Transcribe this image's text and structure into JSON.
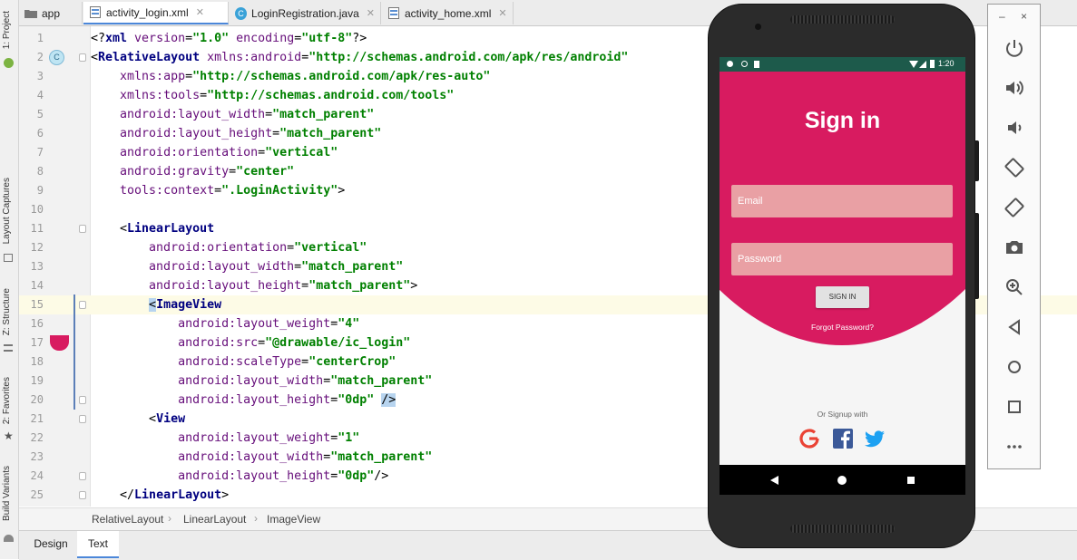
{
  "left_strip": {
    "tabs": [
      "1: Project",
      "Layout Captures",
      "Z: Structure",
      "2: Favorites",
      "Build Variants"
    ]
  },
  "tabs": [
    {
      "label": "app",
      "icon": "folder-icon"
    },
    {
      "label": "activity_login.xml",
      "icon": "xml-layout-icon"
    },
    {
      "label": "LoginRegistration.java",
      "icon": "class-icon"
    },
    {
      "label": "activity_home.xml",
      "icon": "xml-layout-icon"
    }
  ],
  "editor": {
    "gutter_badge": "C",
    "lines": [
      {
        "n": "1",
        "t": [
          [
            "p",
            "<?"
          ],
          [
            "k",
            "xml "
          ],
          [
            "a",
            "version"
          ],
          [
            "p",
            "="
          ],
          [
            "s",
            "\"1.0\""
          ],
          [
            "p",
            " "
          ],
          [
            "a",
            "encoding"
          ],
          [
            "p",
            "="
          ],
          [
            "s",
            "\"utf-8\""
          ],
          [
            "p",
            "?>"
          ]
        ]
      },
      {
        "n": "2",
        "t": [
          [
            "p",
            "<"
          ],
          [
            "k",
            "RelativeLayout "
          ],
          [
            "a",
            "xmlns:android"
          ],
          [
            "p",
            "="
          ],
          [
            "s",
            "\"http://schemas.android.com/apk/res/android\""
          ]
        ]
      },
      {
        "n": "3",
        "t": [
          [
            "p",
            "    "
          ],
          [
            "a",
            "xmlns:app"
          ],
          [
            "p",
            "="
          ],
          [
            "s",
            "\"http://schemas.android.com/apk/res-auto\""
          ]
        ]
      },
      {
        "n": "4",
        "t": [
          [
            "p",
            "    "
          ],
          [
            "a",
            "xmlns:tools"
          ],
          [
            "p",
            "="
          ],
          [
            "s",
            "\"http://schemas.android.com/tools\""
          ]
        ]
      },
      {
        "n": "5",
        "t": [
          [
            "p",
            "    "
          ],
          [
            "a",
            "android:layout_width"
          ],
          [
            "p",
            "="
          ],
          [
            "s",
            "\"match_parent\""
          ]
        ]
      },
      {
        "n": "6",
        "t": [
          [
            "p",
            "    "
          ],
          [
            "a",
            "android:layout_height"
          ],
          [
            "p",
            "="
          ],
          [
            "s",
            "\"match_parent\""
          ]
        ]
      },
      {
        "n": "7",
        "t": [
          [
            "p",
            "    "
          ],
          [
            "a",
            "android:orientation"
          ],
          [
            "p",
            "="
          ],
          [
            "s",
            "\"vertical\""
          ]
        ]
      },
      {
        "n": "8",
        "t": [
          [
            "p",
            "    "
          ],
          [
            "a",
            "android:gravity"
          ],
          [
            "p",
            "="
          ],
          [
            "s",
            "\"center\""
          ]
        ]
      },
      {
        "n": "9",
        "t": [
          [
            "p",
            "    "
          ],
          [
            "a",
            "tools:context"
          ],
          [
            "p",
            "="
          ],
          [
            "s",
            "\".LoginActivity\""
          ],
          [
            "p",
            ">"
          ]
        ]
      },
      {
        "n": "10",
        "t": []
      },
      {
        "n": "11",
        "t": [
          [
            "p",
            "    <"
          ],
          [
            "k",
            "LinearLayout"
          ]
        ]
      },
      {
        "n": "12",
        "t": [
          [
            "p",
            "        "
          ],
          [
            "a",
            "android:orientation"
          ],
          [
            "p",
            "="
          ],
          [
            "s",
            "\"vertical\""
          ]
        ]
      },
      {
        "n": "13",
        "t": [
          [
            "p",
            "        "
          ],
          [
            "a",
            "android:layout_width"
          ],
          [
            "p",
            "="
          ],
          [
            "s",
            "\"match_parent\""
          ]
        ]
      },
      {
        "n": "14",
        "t": [
          [
            "p",
            "        "
          ],
          [
            "a",
            "android:layout_height"
          ],
          [
            "p",
            "="
          ],
          [
            "s",
            "\"match_parent\""
          ],
          [
            "p",
            ">"
          ]
        ]
      },
      {
        "n": "15",
        "t": [
          [
            "p",
            "        "
          ],
          [
            "h",
            "<"
          ],
          [
            "k",
            "ImageView"
          ]
        ]
      },
      {
        "n": "16",
        "t": [
          [
            "p",
            "            "
          ],
          [
            "a",
            "android:layout_weight"
          ],
          [
            "p",
            "="
          ],
          [
            "s",
            "\"4\""
          ]
        ]
      },
      {
        "n": "17",
        "t": [
          [
            "p",
            "            "
          ],
          [
            "a",
            "android:src"
          ],
          [
            "p",
            "="
          ],
          [
            "s",
            "\"@drawable/ic_login\""
          ]
        ]
      },
      {
        "n": "18",
        "t": [
          [
            "p",
            "            "
          ],
          [
            "a",
            "android:scaleType"
          ],
          [
            "p",
            "="
          ],
          [
            "s",
            "\"centerCrop\""
          ]
        ]
      },
      {
        "n": "19",
        "t": [
          [
            "p",
            "            "
          ],
          [
            "a",
            "android:layout_width"
          ],
          [
            "p",
            "="
          ],
          [
            "s",
            "\"match_parent\""
          ]
        ]
      },
      {
        "n": "20",
        "t": [
          [
            "p",
            "            "
          ],
          [
            "a",
            "android:layout_height"
          ],
          [
            "p",
            "="
          ],
          [
            "s",
            "\"0dp\""
          ],
          [
            "p",
            " "
          ],
          [
            "h",
            "/>"
          ]
        ]
      },
      {
        "n": "21",
        "t": [
          [
            "p",
            "        <"
          ],
          [
            "k",
            "View"
          ]
        ]
      },
      {
        "n": "22",
        "t": [
          [
            "p",
            "            "
          ],
          [
            "a",
            "android:layout_weight"
          ],
          [
            "p",
            "="
          ],
          [
            "s",
            "\"1\""
          ]
        ]
      },
      {
        "n": "23",
        "t": [
          [
            "p",
            "            "
          ],
          [
            "a",
            "android:layout_width"
          ],
          [
            "p",
            "="
          ],
          [
            "s",
            "\"match_parent\""
          ]
        ]
      },
      {
        "n": "24",
        "t": [
          [
            "p",
            "            "
          ],
          [
            "a",
            "android:layout_height"
          ],
          [
            "p",
            "="
          ],
          [
            "s",
            "\"0dp\""
          ],
          [
            "p",
            "/>"
          ]
        ]
      },
      {
        "n": "25",
        "t": [
          [
            "p",
            "    </"
          ],
          [
            "k",
            "LinearLayout"
          ],
          [
            "p",
            ">"
          ]
        ]
      }
    ]
  },
  "breadcrumb": [
    "RelativeLayout",
    "LinearLayout",
    "ImageView"
  ],
  "bottom_tabs": {
    "design": "Design",
    "text": "Text"
  },
  "phone": {
    "time": "1:20",
    "title": "Sign in",
    "email_placeholder": "Email",
    "password_placeholder": "Password",
    "signin_button": "SIGN IN",
    "forgot": "Forgot Password?",
    "or_signup": "Or Signup with",
    "colors": {
      "primary": "#d81b60",
      "field": "#e9a0a4",
      "statusbar": "#1d5a4b"
    }
  },
  "emulator_toolbar": {
    "minimize": "–",
    "close": "×",
    "icons": [
      "power-icon",
      "volume-up-icon",
      "volume-down-icon",
      "rotate-left-icon",
      "rotate-right-icon",
      "camera-icon",
      "zoom-icon",
      "back-icon",
      "home-icon",
      "overview-icon",
      "more-icon"
    ]
  }
}
